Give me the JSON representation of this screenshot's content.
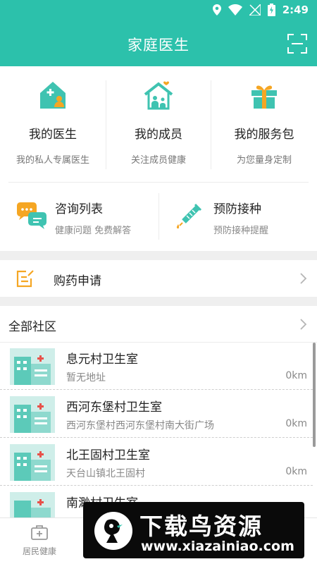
{
  "status": {
    "time": "2:49",
    "battery_text": ""
  },
  "header": {
    "title": "家庭医生"
  },
  "features": [
    {
      "name": "我的医生",
      "desc": "我的私人专属医生",
      "icon": "doctor-house-icon"
    },
    {
      "name": "我的成员",
      "desc": "关注成员健康",
      "icon": "family-house-icon"
    },
    {
      "name": "我的服务包",
      "desc": "为您量身定制",
      "icon": "gift-box-icon"
    }
  ],
  "minis": [
    {
      "name": "咨询列表",
      "desc": "健康问题 免费解答",
      "icon": "chat-bubbles-icon"
    },
    {
      "name": "预防接种",
      "desc": "预防接种提醒",
      "icon": "syringe-icon"
    }
  ],
  "drug": {
    "label": "购药申请"
  },
  "community": {
    "title": "全部社区",
    "clinics": [
      {
        "name": "息元村卫生室",
        "address": "暂无地址",
        "distance": "0km"
      },
      {
        "name": "西河东堡村卫生室",
        "address": "西河东堡村西河东堡村南大街广场",
        "distance": "0km"
      },
      {
        "name": "北王固村卫生室",
        "address": "天台山镇北王固村",
        "distance": "0km"
      },
      {
        "name": "南渺村卫生室",
        "address": "",
        "distance": ""
      }
    ]
  },
  "tabbar": {
    "tab1": "居民健康"
  },
  "watermark": {
    "title": "下载鸟资源",
    "url": "www.xiazainiao.com"
  },
  "colors": {
    "primary": "#2cc1ab",
    "accent_orange": "#f5a623",
    "icon_teal": "#3fc3b1"
  }
}
